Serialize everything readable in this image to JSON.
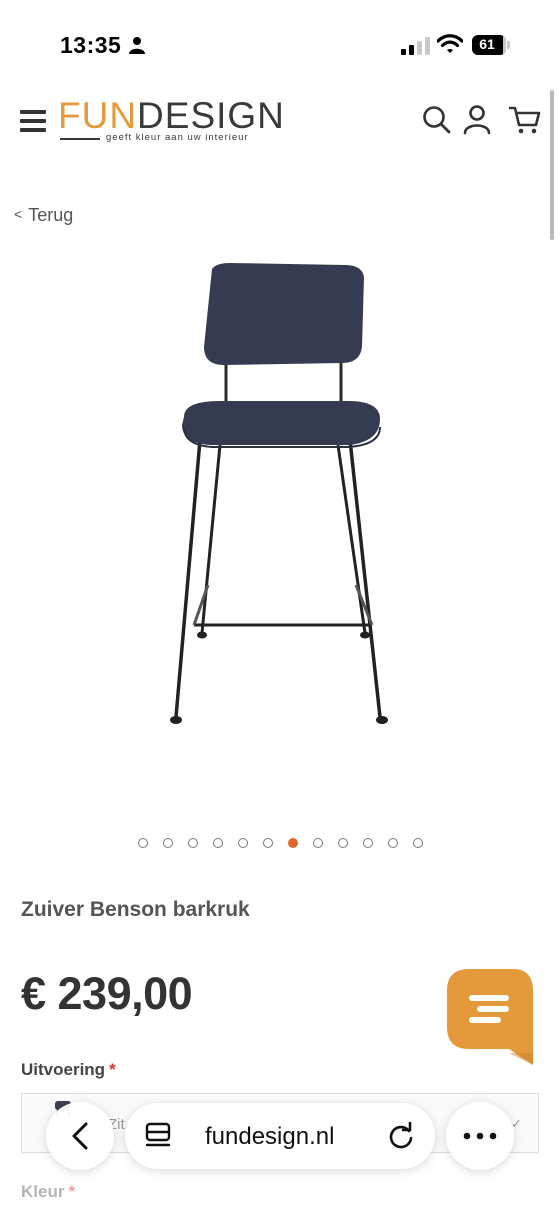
{
  "status_bar": {
    "time": "13:35",
    "battery": "61"
  },
  "header": {
    "logo_fun": "FUN",
    "logo_design": "DESIGN",
    "logo_tagline": "geeft kleur aan uw interieur",
    "icons": [
      "menu-icon",
      "search-icon",
      "account-icon",
      "cart-icon"
    ]
  },
  "back_link": {
    "label": "Terug"
  },
  "carousel": {
    "total_slides": 12,
    "active_index": 6
  },
  "product": {
    "title": "Zuiver Benson barkruk",
    "price": "€ 239,00"
  },
  "options": {
    "uitvoering_label": "Uitvoering",
    "required_mark": "*",
    "uitvoering_value": "Zit",
    "kleur_label": "Kleur"
  },
  "browser": {
    "address": "fundesign.nl"
  },
  "colors": {
    "brand_orange": "#e49a3a",
    "active_dot": "#e0662f",
    "chat_orange": "#e49a3a"
  }
}
